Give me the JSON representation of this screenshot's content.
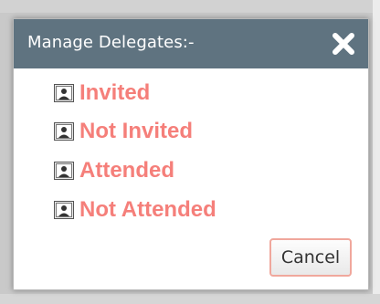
{
  "dialog": {
    "title": "Manage Delegates:-",
    "close_icon": "close-x-icon"
  },
  "options": [
    {
      "label": "Invited",
      "icon": "contact-card-icon"
    },
    {
      "label": "Not Invited",
      "icon": "contact-card-icon"
    },
    {
      "label": "Attended",
      "icon": "contact-card-icon"
    },
    {
      "label": "Not Attended",
      "icon": "contact-card-icon"
    }
  ],
  "buttons": {
    "cancel_label": "Cancel"
  },
  "colors": {
    "titlebar": "#5f7380",
    "option_text": "#f57f7a",
    "cancel_border": "#f0a79c"
  }
}
